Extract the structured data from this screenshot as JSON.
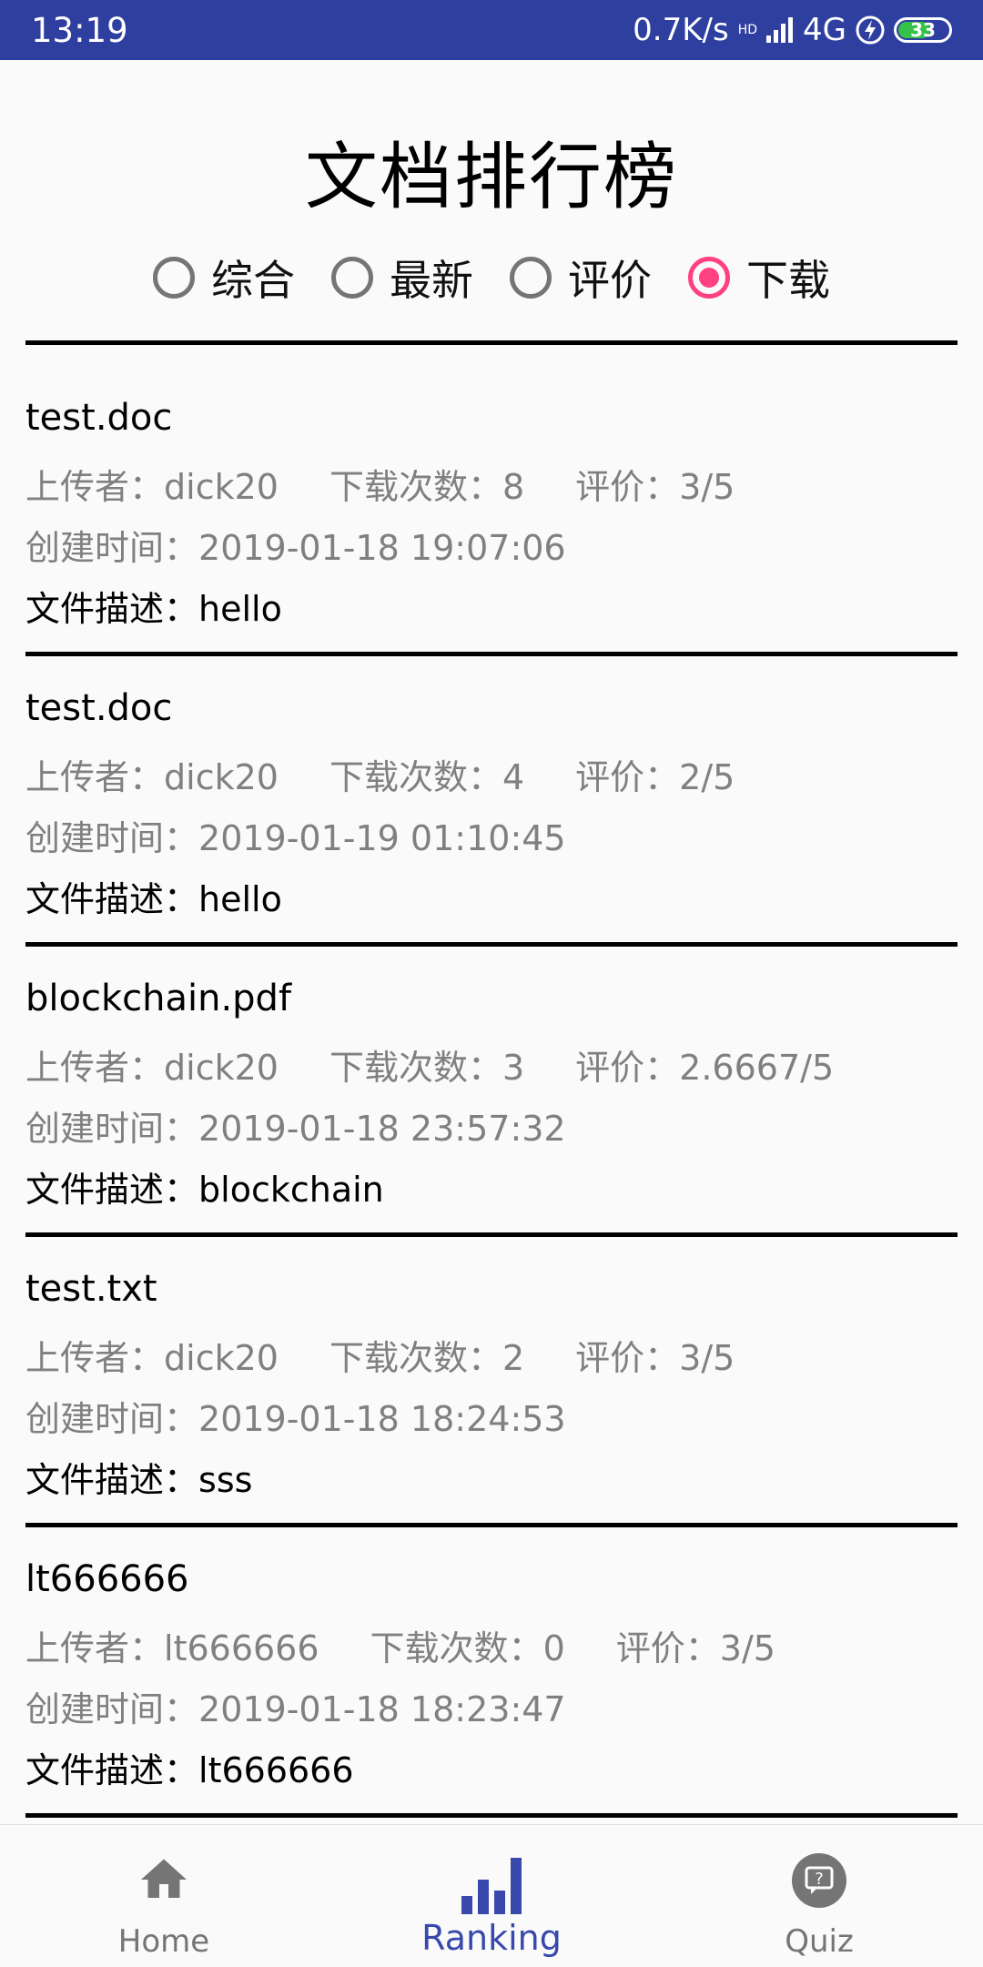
{
  "status_bar": {
    "time": "13:19",
    "network_speed": "0.7K/s",
    "signal_badge": "HD",
    "network_type": "4G",
    "battery_level": "33",
    "battery_color": "#36c24a"
  },
  "header": {
    "title": "文档排行榜"
  },
  "sort_options": [
    {
      "label": "综合",
      "checked": false
    },
    {
      "label": "最新",
      "checked": false
    },
    {
      "label": "评价",
      "checked": false
    },
    {
      "label": "下载",
      "checked": true
    }
  ],
  "labels": {
    "uploader": "上传者：",
    "downloads": "下载次数：",
    "rating": "评价：",
    "created": "创建时间：",
    "description": "文件描述："
  },
  "documents": [
    {
      "name": "test.doc",
      "uploader": "dick20",
      "downloads": "8",
      "rating": "3/5",
      "created": "2019-01-18 19:07:06",
      "description": "hello"
    },
    {
      "name": "test.doc",
      "uploader": "dick20",
      "downloads": "4",
      "rating": "2/5",
      "created": "2019-01-19 01:10:45",
      "description": "hello"
    },
    {
      "name": "blockchain.pdf",
      "uploader": "dick20",
      "downloads": "3",
      "rating": "2.6667/5",
      "created": "2019-01-18 23:57:32",
      "description": "blockchain"
    },
    {
      "name": "test.txt",
      "uploader": "dick20",
      "downloads": "2",
      "rating": "3/5",
      "created": "2019-01-18 18:24:53",
      "description": "sss"
    },
    {
      "name": "lt666666",
      "uploader": "lt666666",
      "downloads": "0",
      "rating": "3/5",
      "created": "2019-01-18 18:23:47",
      "description": "lt666666"
    }
  ],
  "bottom_nav": {
    "items": [
      {
        "label": "Home",
        "icon": "home-icon",
        "active": false
      },
      {
        "label": "Ranking",
        "icon": "bar-chart-icon",
        "active": true
      },
      {
        "label": "Quiz",
        "icon": "quiz-icon",
        "active": false
      }
    ]
  },
  "colors": {
    "primary": "#2f3f9f",
    "accent": "#ff4081",
    "nav_active": "#3949ab",
    "nav_inactive": "#757575"
  }
}
